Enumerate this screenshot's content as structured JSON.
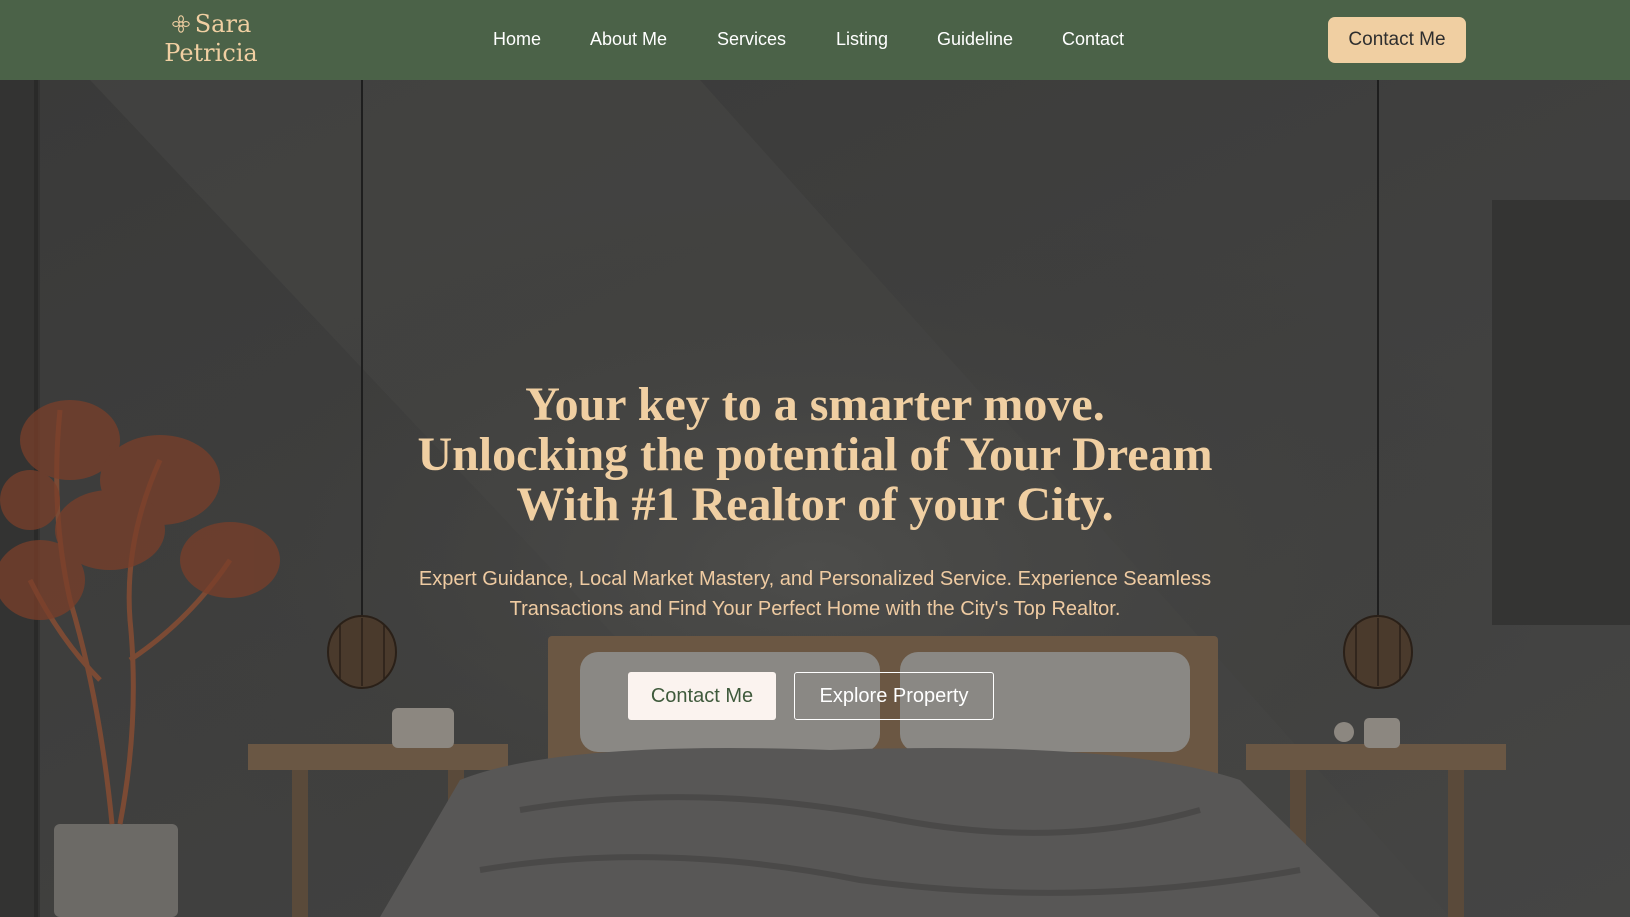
{
  "brand": {
    "name_line1": "Sara",
    "name_line2": "Petricia",
    "icon": "flower-icon"
  },
  "nav": {
    "items": [
      "Home",
      "About Me",
      "Services",
      "Listing",
      "Guideline",
      "Contact"
    ],
    "cta_label": "Contact Me"
  },
  "hero": {
    "title_line1": "Your key to a smarter move.",
    "title_line2": "Unlocking the potential of Your Dream",
    "title_line3": "With #1 Realtor of your City.",
    "subtitle_line1": "Expert Guidance, Local Market Mastery, and Personalized Service. Experience Seamless",
    "subtitle_line2": "Transactions and Find Your Perfect Home with the City's Top Realtor.",
    "primary_label": "Contact Me",
    "secondary_label": "Explore Property"
  },
  "colors": {
    "header_bg": "#4b6248",
    "accent": "#f0cfa2",
    "hero_overlay": "#3a3a38"
  }
}
